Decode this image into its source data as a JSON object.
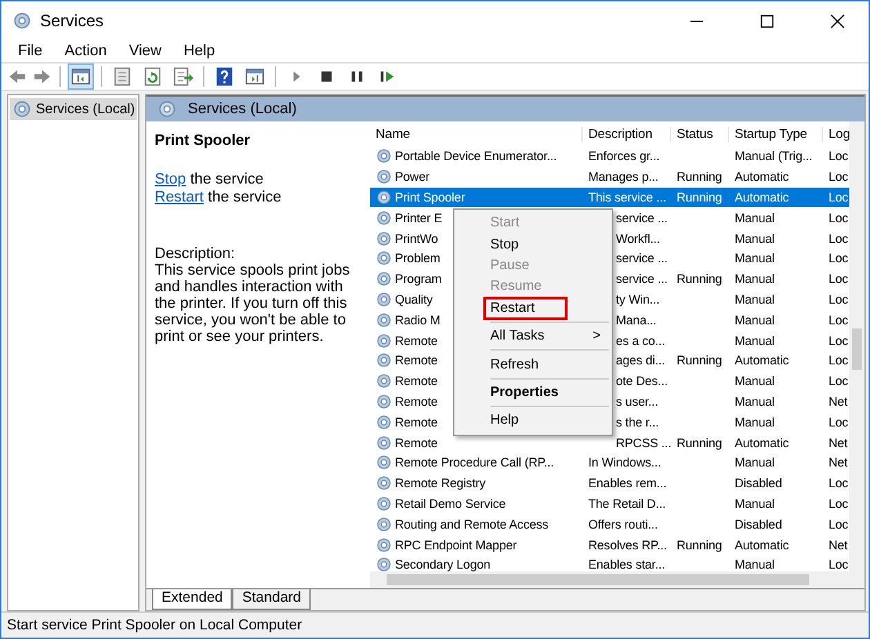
{
  "window": {
    "title": "Services"
  },
  "menu_bar": [
    "File",
    "Action",
    "View",
    "Help"
  ],
  "toolbar": [
    {
      "kind": "back"
    },
    {
      "kind": "forward"
    },
    {
      "kind": "sep"
    },
    {
      "kind": "pane",
      "selected": true
    },
    {
      "kind": "sep"
    },
    {
      "kind": "page",
      "selected": false
    },
    {
      "kind": "refresh",
      "selected": false
    },
    {
      "kind": "export",
      "selected": false
    },
    {
      "kind": "sep"
    },
    {
      "kind": "help",
      "selected": false
    },
    {
      "kind": "pane2",
      "selected": false
    },
    {
      "kind": "sep"
    },
    {
      "kind": "play",
      "selected": false
    },
    {
      "kind": "stop",
      "selected": false
    },
    {
      "kind": "pause",
      "selected": false
    },
    {
      "kind": "resume",
      "selected": false
    }
  ],
  "tree": {
    "items": [
      {
        "label": "Services (Local)",
        "selected": true
      }
    ]
  },
  "pane_header": "Services (Local)",
  "details": {
    "title": "Print Spooler",
    "actions": [
      {
        "link": "Stop",
        "text": " the service"
      },
      {
        "link": "Restart",
        "text": " the service"
      }
    ],
    "description_label": "Description:",
    "description": "This service spools print jobs and handles interaction with the printer. If you turn off this service, you won't be able to print or see your printers."
  },
  "table": {
    "columns": [
      "Name",
      "Description",
      "Status",
      "Startup Type",
      "Log"
    ],
    "rows": [
      {
        "name": "Portable Device Enumerator...",
        "description": "Enforces gr...",
        "status": "",
        "startup": "Manual (Trig...",
        "logon": "Loc",
        "selected": false,
        "covered": false
      },
      {
        "name": "Power",
        "description": "Manages p...",
        "status": "Running",
        "startup": "Automatic",
        "logon": "Loc",
        "selected": false,
        "covered": false
      },
      {
        "name": "Print Spooler",
        "description": "This service ...",
        "status": "Running",
        "startup": "Automatic",
        "logon": "Loc",
        "selected": true,
        "covered": false
      },
      {
        "name": "Printer E",
        "description": "service ...",
        "status": "",
        "startup": "Manual",
        "logon": "Loc",
        "selected": false,
        "covered": true
      },
      {
        "name": "PrintWo",
        "description": "Workfl...",
        "status": "",
        "startup": "Manual",
        "logon": "Loc",
        "selected": false,
        "covered": true
      },
      {
        "name": "Problem",
        "description": "service ...",
        "status": "",
        "startup": "Manual",
        "logon": "Loc",
        "selected": false,
        "covered": true
      },
      {
        "name": "Program",
        "description": "service ...",
        "status": "Running",
        "startup": "Manual",
        "logon": "Loc",
        "selected": false,
        "covered": true
      },
      {
        "name": "Quality",
        "description": "ty Win...",
        "status": "",
        "startup": "Manual",
        "logon": "Loc",
        "selected": false,
        "covered": true
      },
      {
        "name": "Radio M",
        "description": "Mana...",
        "status": "",
        "startup": "Manual",
        "logon": "Loc",
        "selected": false,
        "covered": true
      },
      {
        "name": "Remote",
        "description": "es a co...",
        "status": "",
        "startup": "Manual",
        "logon": "Loc",
        "selected": false,
        "covered": true
      },
      {
        "name": "Remote",
        "description": "ages di...",
        "status": "Running",
        "startup": "Automatic",
        "logon": "Loc",
        "selected": false,
        "covered": true
      },
      {
        "name": "Remote",
        "description": "ote Des...",
        "status": "",
        "startup": "Manual",
        "logon": "Loc",
        "selected": false,
        "covered": true
      },
      {
        "name": "Remote",
        "description": "s user...",
        "status": "",
        "startup": "Manual",
        "logon": "Net",
        "selected": false,
        "covered": true
      },
      {
        "name": "Remote",
        "description": "s the r...",
        "status": "",
        "startup": "Manual",
        "logon": "Loc",
        "selected": false,
        "covered": true
      },
      {
        "name": "Remote",
        "description": "RPCSS ...",
        "status": "Running",
        "startup": "Automatic",
        "logon": "Net",
        "selected": false,
        "covered": true
      },
      {
        "name": "Remote Procedure Call (RP...",
        "description": "In Windows...",
        "status": "",
        "startup": "Manual",
        "logon": "Net",
        "selected": false,
        "covered": false
      },
      {
        "name": "Remote Registry",
        "description": "Enables rem...",
        "status": "",
        "startup": "Disabled",
        "logon": "Loc",
        "selected": false,
        "covered": false
      },
      {
        "name": "Retail Demo Service",
        "description": "The Retail D...",
        "status": "",
        "startup": "Manual",
        "logon": "Loc",
        "selected": false,
        "covered": false
      },
      {
        "name": "Routing and Remote Access",
        "description": "Offers routi...",
        "status": "",
        "startup": "Disabled",
        "logon": "Loc",
        "selected": false,
        "covered": false
      },
      {
        "name": "RPC Endpoint Mapper",
        "description": "Resolves RP...",
        "status": "Running",
        "startup": "Automatic",
        "logon": "Net",
        "selected": false,
        "covered": false
      },
      {
        "name": "Secondary Logon",
        "description": "Enables star...",
        "status": "",
        "startup": "Manual",
        "logon": "Loc",
        "selected": false,
        "covered": false
      }
    ]
  },
  "context_menu": [
    {
      "kind": "item",
      "label": "Start",
      "disabled": true,
      "bold": false,
      "highlighted": false
    },
    {
      "kind": "item",
      "label": "Stop",
      "disabled": false,
      "bold": false,
      "highlighted": false
    },
    {
      "kind": "item",
      "label": "Pause",
      "disabled": true,
      "bold": false,
      "highlighted": false
    },
    {
      "kind": "item",
      "label": "Resume",
      "disabled": true,
      "bold": false,
      "highlighted": false
    },
    {
      "kind": "item",
      "label": "Restart",
      "disabled": false,
      "bold": false,
      "highlighted": true
    },
    {
      "kind": "separator"
    },
    {
      "kind": "submenu",
      "label": "All Tasks",
      "arrow": ">",
      "disabled": false,
      "bold": false,
      "highlighted": false
    },
    {
      "kind": "separator"
    },
    {
      "kind": "item",
      "label": "Refresh",
      "disabled": false,
      "bold": false,
      "highlighted": false
    },
    {
      "kind": "separator"
    },
    {
      "kind": "item",
      "label": "Properties",
      "disabled": false,
      "bold": true,
      "highlighted": false
    },
    {
      "kind": "separator"
    },
    {
      "kind": "item",
      "label": "Help",
      "disabled": false,
      "bold": false,
      "highlighted": false
    }
  ],
  "view_tabs": [
    {
      "label": "Extended",
      "selected": true
    },
    {
      "label": "Standard",
      "selected": false
    }
  ],
  "status_bar": "Start service Print Spooler on Local Computer"
}
